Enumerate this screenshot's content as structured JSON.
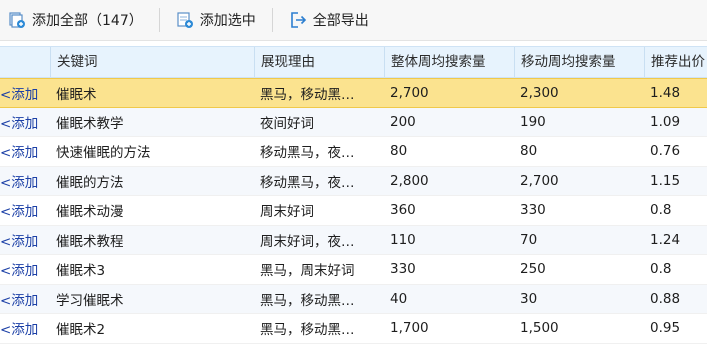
{
  "toolbar": {
    "add_all_label": "添加全部（147）",
    "add_selected_label": "添加选中",
    "export_all_label": "全部导出",
    "icons": [
      "add-all-icon",
      "add-selected-icon",
      "export-icon"
    ]
  },
  "columns": [
    "",
    "关键词",
    "展现理由",
    "整体周均搜索量",
    "移动周均搜索量",
    "推荐出价"
  ],
  "add_link_label": "<添加",
  "rows": [
    {
      "keyword": "催眠术",
      "reason": "黑马，移动黑…",
      "overall": "2,700",
      "mobile": "2,300",
      "bid": "1.48",
      "selected": true
    },
    {
      "keyword": "催眠术教学",
      "reason": "夜间好词",
      "overall": "200",
      "mobile": "190",
      "bid": "1.09"
    },
    {
      "keyword": "快速催眠的方法",
      "reason": "移动黑马，夜…",
      "overall": "80",
      "mobile": "80",
      "bid": "0.76"
    },
    {
      "keyword": "催眠的方法",
      "reason": "移动黑马，夜…",
      "overall": "2,800",
      "mobile": "2,700",
      "bid": "1.15"
    },
    {
      "keyword": "催眠术动漫",
      "reason": "周末好词",
      "overall": "360",
      "mobile": "330",
      "bid": "0.8"
    },
    {
      "keyword": "催眠术教程",
      "reason": "周末好词，夜…",
      "overall": "110",
      "mobile": "70",
      "bid": "1.24"
    },
    {
      "keyword": "催眠术3",
      "reason": "黑马，周末好词",
      "overall": "330",
      "mobile": "250",
      "bid": "0.8"
    },
    {
      "keyword": "学习催眠术",
      "reason": "黑马，移动黑…",
      "overall": "40",
      "mobile": "30",
      "bid": "0.88"
    },
    {
      "keyword": "催眠术2",
      "reason": "黑马，移动黑…",
      "overall": "1,700",
      "mobile": "1,500",
      "bid": "0.95"
    }
  ],
  "colors": {
    "selected_row": "#fbe38f",
    "header_bg": "#e7f3fd",
    "link": "#1b3fa6"
  }
}
